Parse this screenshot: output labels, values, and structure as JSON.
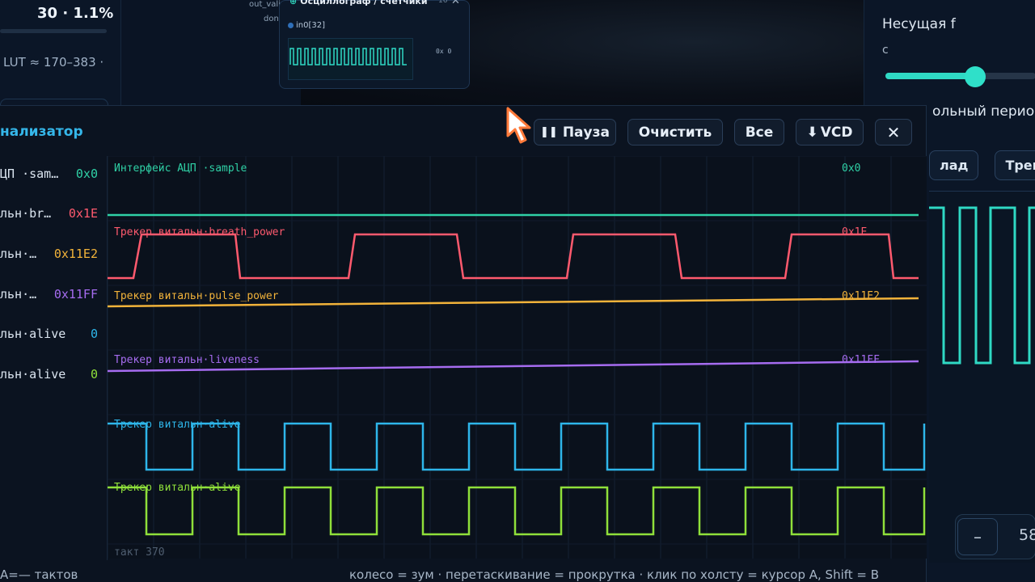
{
  "background": {
    "stat_value": "30 · 1.1%",
    "lut_text": "LUT ≈ 170–383 ·",
    "mid_labels": [
      "out_vali",
      "don"
    ],
    "scope": {
      "title": "Осциллограф / счётчики",
      "badge": "16",
      "port_label": "in0[32]",
      "value": "0x 0"
    },
    "right_panel": {
      "carrier_label": "Несущая f",
      "carrier_sub": "с",
      "period_label": "ольный период",
      "tabs": [
        "лад",
        "Трекер"
      ],
      "stepper_minus": "–",
      "stepper_value": "58"
    }
  },
  "analyzer": {
    "title": "нализатор",
    "toolbar": {
      "pause": "Пауза",
      "clear": "Очистить",
      "all": "Все",
      "vcd": "VCD",
      "close": "✕"
    },
    "signals": [
      {
        "label": "ЦП ·sam…",
        "value": "0x0",
        "color": "#2fd1a6",
        "trace_name": "Интерфейс АЦП ·sample",
        "trace_value": "0x0"
      },
      {
        "label": "льн·br…",
        "value": "0x1E",
        "color": "#ff5a6e",
        "trace_name": "Трекер витальн·breath_power",
        "trace_value": "0x1E"
      },
      {
        "label": "льн·…",
        "value": "0x11E2",
        "color": "#f2b33a",
        "trace_name": "Трекер витальн·pulse_power",
        "trace_value": "0x11E2"
      },
      {
        "label": "льн·…",
        "value": "0x11FF",
        "color": "#a66cf0",
        "trace_name": "Трекер витальн·liveness",
        "trace_value": "0x11FF"
      },
      {
        "label": "льн·alive",
        "value": "0",
        "color": "#2eb6ea",
        "trace_name": "Трекер витальн·alive",
        "trace_value": ""
      },
      {
        "label": "льн·alive",
        "value": "0",
        "color": "#8fe03a",
        "trace_name": "Трекер витальн·alive",
        "trace_value": ""
      }
    ],
    "tick_label": "такт 370",
    "footer_left": "A=— тактов",
    "footer_right": "колесо = зум · перетаскивание = прокрутка · клик по холсту = курсор A, Shift = B"
  },
  "colors": {
    "accent": "#35b7ea",
    "teal": "#2fd9c4"
  }
}
